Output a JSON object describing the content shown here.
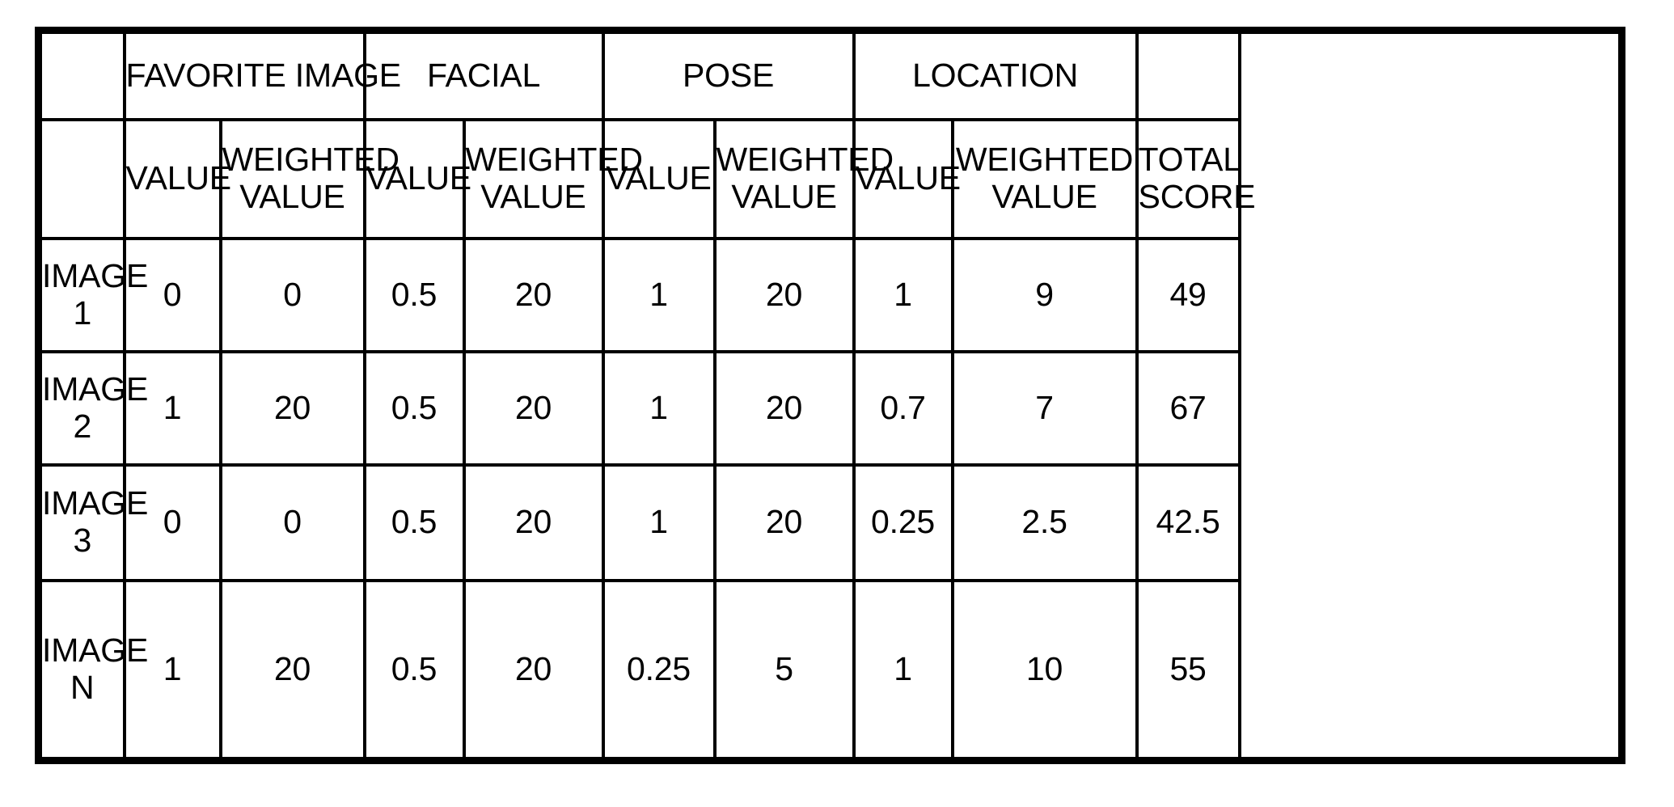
{
  "table": {
    "group_headers": [
      {
        "label": "",
        "span": 1
      },
      {
        "label": "FAVORITE IMAGE",
        "span": 2
      },
      {
        "label": "FACIAL",
        "span": 2
      },
      {
        "label": "POSE",
        "span": 2
      },
      {
        "label": "LOCATION",
        "span": 2
      },
      {
        "label": "",
        "span": 1
      }
    ],
    "sub_headers": [
      "",
      "VALUE",
      "WEIGHTED VALUE",
      "VALUE",
      "WEIGHTED VALUE",
      "VALUE",
      "WEIGHTED VALUE",
      "VALUE",
      "WEIGHTED VALUE",
      "TOTAL SCORE"
    ],
    "rows": [
      {
        "label": "IMAGE 1",
        "favorite_value": "0",
        "favorite_weighted": "0",
        "facial_value": "0.5",
        "facial_weighted": "20",
        "pose_value": "1",
        "pose_weighted": "20",
        "location_value": "1",
        "location_weighted": "9",
        "total_score": "49"
      },
      {
        "label": "IMAGE 2",
        "favorite_value": "1",
        "favorite_weighted": "20",
        "facial_value": "0.5",
        "facial_weighted": "20",
        "pose_value": "1",
        "pose_weighted": "20",
        "location_value": "0.7",
        "location_weighted": "7",
        "total_score": "67"
      },
      {
        "label": "IMAGE 3",
        "favorite_value": "0",
        "favorite_weighted": "0",
        "facial_value": "0.5",
        "facial_weighted": "20",
        "pose_value": "1",
        "pose_weighted": "20",
        "location_value": "0.25",
        "location_weighted": "2.5",
        "total_score": "42.5"
      },
      {
        "label": "IMAGE N",
        "favorite_value": "1",
        "favorite_weighted": "20",
        "facial_value": "0.5",
        "facial_weighted": "20",
        "pose_value": "0.25",
        "pose_weighted": "5",
        "location_value": "1",
        "location_weighted": "10",
        "total_score": "55"
      }
    ]
  },
  "colors": {
    "border": "#000000",
    "text": "#000000",
    "background": "#ffffff"
  }
}
